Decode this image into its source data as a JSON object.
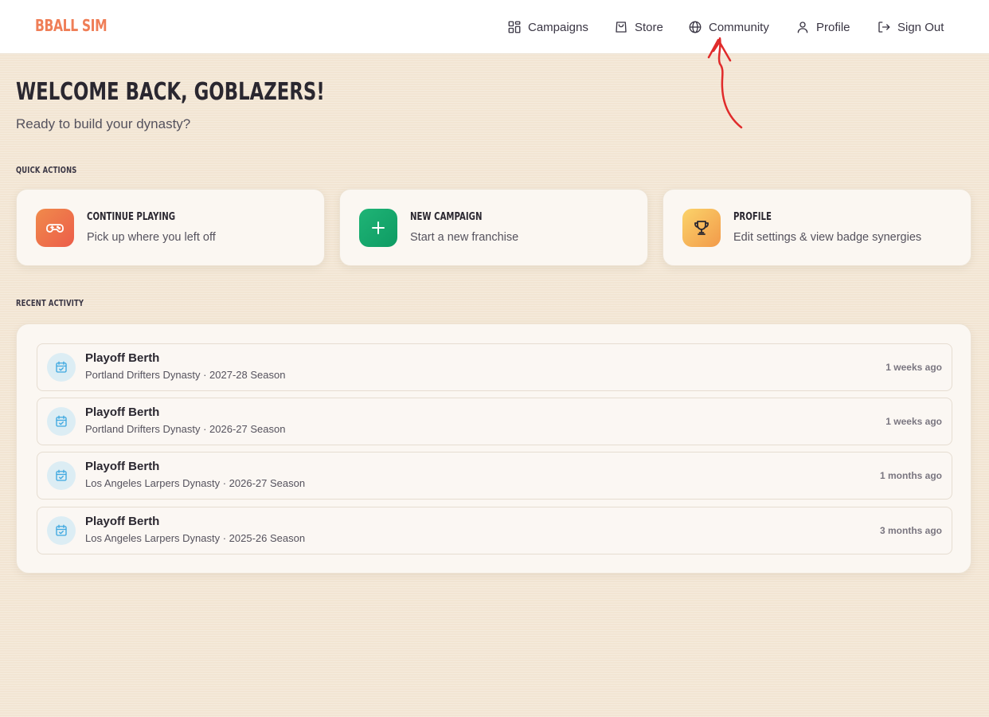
{
  "brand": "BBALL SIM",
  "nav": [
    {
      "label": "Campaigns",
      "icon": "campaigns-grid-icon"
    },
    {
      "label": "Store",
      "icon": "shopping-bag-icon"
    },
    {
      "label": "Community",
      "icon": "globe-icon"
    },
    {
      "label": "Profile",
      "icon": "user-icon"
    },
    {
      "label": "Sign Out",
      "icon": "sign-out-icon"
    }
  ],
  "welcome": {
    "title": "WELCOME BACK, GOBLAZERS!",
    "subtitle": "Ready to build your dynasty?"
  },
  "sections": {
    "quick_actions": "QUICK ACTIONS",
    "recent_activity": "RECENT ACTIVITY"
  },
  "quick_actions": [
    {
      "title": "CONTINUE PLAYING",
      "desc": "Pick up where you left off",
      "icon": "gamepad-icon",
      "color_from": "#f08a4b",
      "color_to": "#ec5d4a"
    },
    {
      "title": "NEW CAMPAIGN",
      "desc": "Start a new franchise",
      "icon": "plus-icon",
      "color_from": "#1fb476",
      "color_to": "#0e9b63"
    },
    {
      "title": "PROFILE",
      "desc": "Edit settings & view badge synergies",
      "icon": "trophy-icon",
      "color_from": "#fbd36a",
      "color_to": "#f29a4a"
    }
  ],
  "activity": [
    {
      "title": "Playoff Berth",
      "sub": "Portland Drifters Dynasty · 2027-28 Season",
      "time": "1 weeks ago",
      "icon": "calendar-check-icon"
    },
    {
      "title": "Playoff Berth",
      "sub": "Portland Drifters Dynasty · 2026-27 Season",
      "time": "1 weeks ago",
      "icon": "calendar-check-icon"
    },
    {
      "title": "Playoff Berth",
      "sub": "Los Angeles Larpers Dynasty · 2026-27 Season",
      "time": "1 months ago",
      "icon": "calendar-check-icon"
    },
    {
      "title": "Playoff Berth",
      "sub": "Los Angeles Larpers Dynasty · 2025-26 Season",
      "time": "3 months ago",
      "icon": "calendar-check-icon"
    }
  ],
  "colors": {
    "brand": "#ef7e57",
    "background": "#f2e5d3",
    "annotation": "#e02b2b",
    "activity_icon": "#3ea8e0"
  }
}
